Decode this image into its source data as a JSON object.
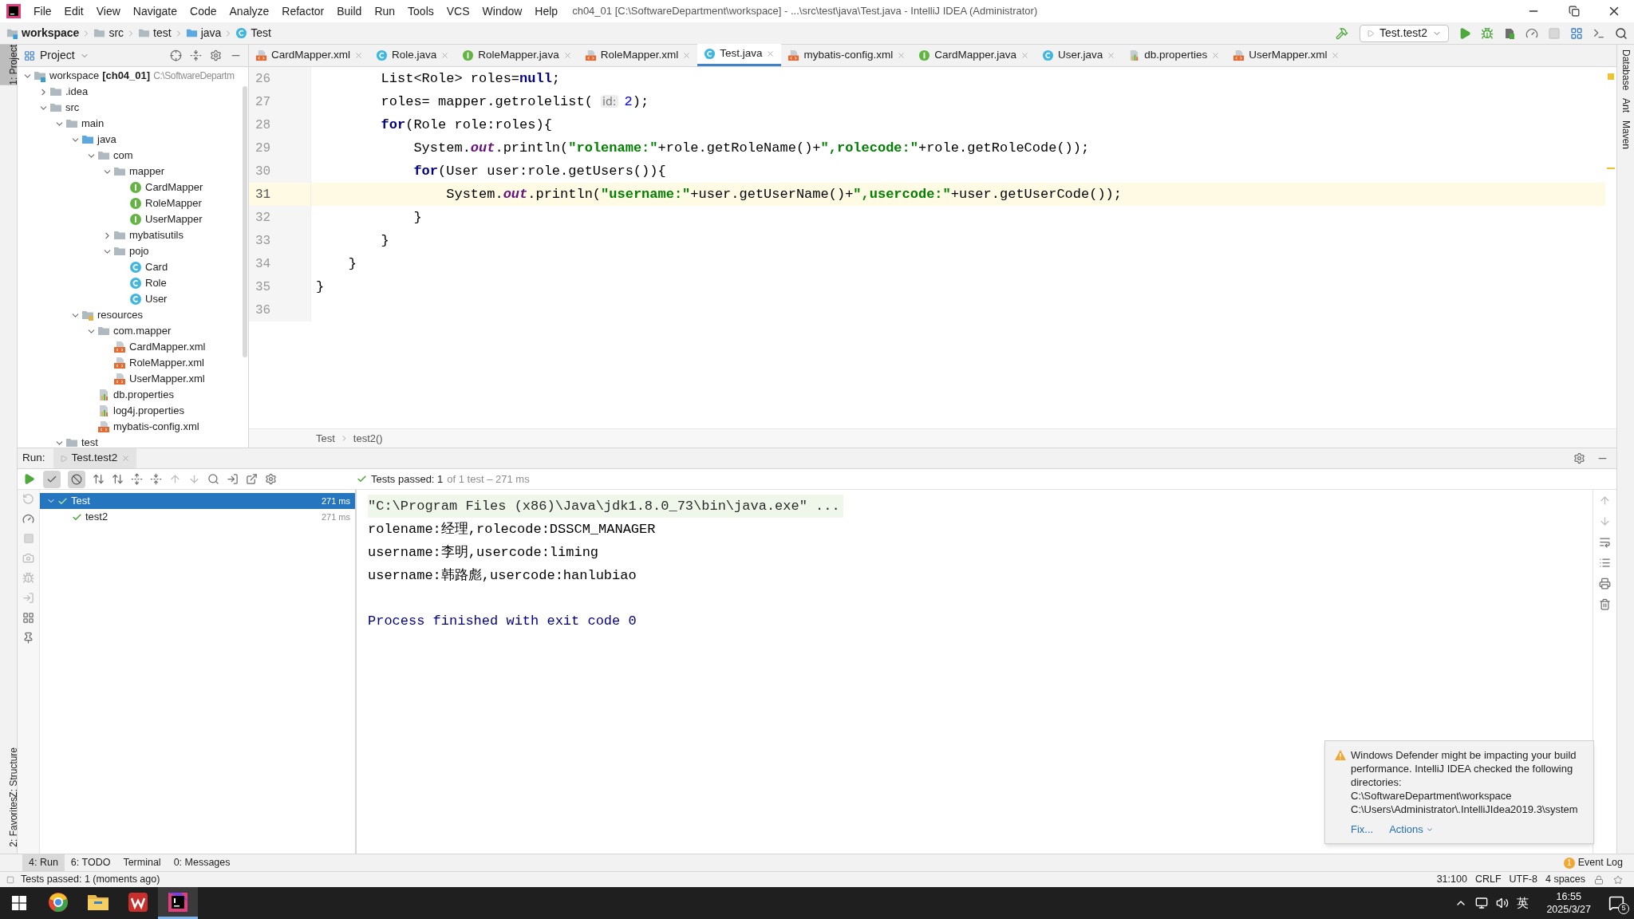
{
  "window": {
    "title": "ch04_01 [C:\\SoftwareDepartment\\workspace] - ...\\src\\test\\java\\Test.java - IntelliJ IDEA (Administrator)",
    "menu": [
      "File",
      "Edit",
      "View",
      "Navigate",
      "Code",
      "Analyze",
      "Refactor",
      "Build",
      "Run",
      "Tools",
      "VCS",
      "Window",
      "Help"
    ]
  },
  "nav_bar": {
    "breadcrumbs": [
      {
        "label": "workspace",
        "kind": "module"
      },
      {
        "label": "src",
        "kind": "folder"
      },
      {
        "label": "test",
        "kind": "folder"
      },
      {
        "label": "java",
        "kind": "source-folder"
      },
      {
        "label": "Test",
        "kind": "class"
      }
    ],
    "run_config": "Test.test2"
  },
  "left_stripe": [
    {
      "label": "1: Project",
      "selected": true
    },
    {
      "label": "Z: Structure",
      "selected": false
    },
    {
      "label": "2: Favorites",
      "selected": false
    }
  ],
  "right_stripe": [
    "Database",
    "Ant",
    "Maven"
  ],
  "project_panel": {
    "title": "Project",
    "tree": [
      {
        "label": "workspace",
        "module": "[ch04_01]",
        "path": "C:\\SoftwareDepartm",
        "kind": "module",
        "expanded": true,
        "children": [
          {
            "label": ".idea",
            "kind": "folder",
            "expanded": false
          },
          {
            "label": "src",
            "kind": "folder",
            "expanded": true,
            "children": [
              {
                "label": "main",
                "kind": "folder",
                "expanded": true,
                "children": [
                  {
                    "label": "java",
                    "kind": "source-folder",
                    "expanded": true,
                    "children": [
                      {
                        "label": "com",
                        "kind": "folder",
                        "expanded": true,
                        "children": [
                          {
                            "label": "mapper",
                            "kind": "folder",
                            "expanded": true,
                            "children": [
                              {
                                "label": "CardMapper",
                                "kind": "interface"
                              },
                              {
                                "label": "RoleMapper",
                                "kind": "interface"
                              },
                              {
                                "label": "UserMapper",
                                "kind": "interface"
                              }
                            ]
                          },
                          {
                            "label": "mybatisutils",
                            "kind": "folder",
                            "expanded": false
                          },
                          {
                            "label": "pojo",
                            "kind": "folder",
                            "expanded": true,
                            "children": [
                              {
                                "label": "Card",
                                "kind": "class"
                              },
                              {
                                "label": "Role",
                                "kind": "class"
                              },
                              {
                                "label": "User",
                                "kind": "class"
                              }
                            ]
                          }
                        ]
                      }
                    ]
                  },
                  {
                    "label": "resources",
                    "kind": "resources-folder",
                    "expanded": true,
                    "children": [
                      {
                        "label": "com.mapper",
                        "kind": "folder",
                        "expanded": true,
                        "children": [
                          {
                            "label": "CardMapper.xml",
                            "kind": "xml"
                          },
                          {
                            "label": "RoleMapper.xml",
                            "kind": "xml"
                          },
                          {
                            "label": "UserMapper.xml",
                            "kind": "xml"
                          }
                        ]
                      },
                      {
                        "label": "db.properties",
                        "kind": "properties"
                      },
                      {
                        "label": "log4j.properties",
                        "kind": "properties"
                      },
                      {
                        "label": "mybatis-config.xml",
                        "kind": "xml"
                      }
                    ]
                  }
                ]
              },
              {
                "label": "test",
                "kind": "folder",
                "expanded": true
              }
            ]
          }
        ]
      }
    ]
  },
  "editor": {
    "tabs": [
      {
        "label": "CardMapper.xml",
        "kind": "xml",
        "selected": false
      },
      {
        "label": "Role.java",
        "kind": "class",
        "selected": false
      },
      {
        "label": "RoleMapper.java",
        "kind": "interface",
        "selected": false
      },
      {
        "label": "RoleMapper.xml",
        "kind": "xml",
        "selected": false
      },
      {
        "label": "Test.java",
        "kind": "class",
        "selected": true
      },
      {
        "label": "mybatis-config.xml",
        "kind": "xml",
        "selected": false
      },
      {
        "label": "CardMapper.java",
        "kind": "interface",
        "selected": false
      },
      {
        "label": "User.java",
        "kind": "class",
        "selected": false
      },
      {
        "label": "db.properties",
        "kind": "properties",
        "selected": false
      },
      {
        "label": "UserMapper.xml",
        "kind": "xml",
        "selected": false
      }
    ],
    "lines": [
      {
        "number": "26",
        "current": false,
        "segments": [
          {
            "kind": "plain",
            "text": "        List<Role> roles="
          },
          {
            "kind": "keyword",
            "text": "null"
          },
          {
            "kind": "plain",
            "text": ";"
          }
        ]
      },
      {
        "number": "27",
        "current": false,
        "segments": [
          {
            "kind": "plain",
            "text": "        roles= mapper.getrolelist( "
          },
          {
            "kind": "hint",
            "text": "id:"
          },
          {
            "kind": "number",
            "text": "2"
          },
          {
            "kind": "plain",
            "text": ");"
          }
        ]
      },
      {
        "number": "28",
        "current": false,
        "segments": [
          {
            "kind": "keyword",
            "text": "        for"
          },
          {
            "kind": "plain",
            "text": "(Role role:roles){"
          }
        ]
      },
      {
        "number": "29",
        "current": false,
        "segments": [
          {
            "kind": "plain",
            "text": "            System."
          },
          {
            "kind": "field",
            "text": "out"
          },
          {
            "kind": "plain",
            "text": ".println("
          },
          {
            "kind": "string",
            "text": "\"rolename:\""
          },
          {
            "kind": "plain",
            "text": "+role.getRoleName()+"
          },
          {
            "kind": "string",
            "text": "\",rolecode:\""
          },
          {
            "kind": "plain",
            "text": "+role.getRoleCode());"
          }
        ]
      },
      {
        "number": "30",
        "current": false,
        "segments": [
          {
            "kind": "keyword",
            "text": "            for"
          },
          {
            "kind": "plain",
            "text": "(User user:role.getUsers()){"
          }
        ]
      },
      {
        "number": "31",
        "current": true,
        "segments": [
          {
            "kind": "plain",
            "text": "                System."
          },
          {
            "kind": "field",
            "text": "out"
          },
          {
            "kind": "plain",
            "text": ".println("
          },
          {
            "kind": "string",
            "text": "\"username:\""
          },
          {
            "kind": "plain",
            "text": "+user.getUserName()+"
          },
          {
            "kind": "string",
            "text": "\",usercode:\""
          },
          {
            "kind": "plain",
            "text": "+user.getUserCode());"
          }
        ]
      },
      {
        "number": "32",
        "current": false,
        "segments": [
          {
            "kind": "plain",
            "text": "            }"
          }
        ]
      },
      {
        "number": "33",
        "current": false,
        "segments": [
          {
            "kind": "plain",
            "text": "        }"
          }
        ]
      },
      {
        "number": "34",
        "current": false,
        "segments": [
          {
            "kind": "plain",
            "text": "    }"
          }
        ]
      },
      {
        "number": "35",
        "current": false,
        "segments": [
          {
            "kind": "plain",
            "text": "}"
          }
        ]
      },
      {
        "number": "36",
        "current": false
      }
    ],
    "breadcrumb": [
      "Test",
      "test2()"
    ]
  },
  "run_panel": {
    "label": "Run:",
    "tab": "Test.test2",
    "toggles": [
      {
        "kind": "show-passed",
        "selected": true
      },
      {
        "kind": "show-ignored",
        "selected": true
      }
    ],
    "status": {
      "summary": "Tests passed: 1",
      "detail": "of 1 test – 271 ms"
    },
    "tests": [
      {
        "name": "Test",
        "time": "271 ms",
        "passed": true,
        "selected": true,
        "expanded": true,
        "children": [
          {
            "name": "test2",
            "time": "271 ms",
            "passed": true,
            "selected": false
          }
        ]
      }
    ],
    "console": [
      {
        "kind": "command",
        "text": "\"C:\\Program Files (x86)\\Java\\jdk1.8.0_73\\bin\\java.exe\" ..."
      },
      {
        "kind": "output",
        "text": "rolename:经理,rolecode:DSSCM_MANAGER"
      },
      {
        "kind": "output",
        "text": "username:李明,usercode:liming"
      },
      {
        "kind": "output",
        "text": "username:韩路彪,usercode:hanlubiao"
      },
      {
        "kind": "exit",
        "text": "Process finished with exit code 0"
      }
    ]
  },
  "notification": {
    "message": "Windows Defender might be impacting your build performance. IntelliJ IDEA checked the following directories:",
    "paths": [
      "C:\\SoftwareDepartment\\workspace",
      "C:\\Users\\Administrator\\.IntelliJIdea2019.3\\system"
    ],
    "links": [
      "Fix...",
      "Actions"
    ]
  },
  "tool_tabs": [
    {
      "label": "4: Run",
      "selected": true
    },
    {
      "label": "6: TODO",
      "selected": false
    },
    {
      "label": "Terminal",
      "selected": false
    },
    {
      "label": "0: Messages",
      "selected": false
    }
  ],
  "event_log": {
    "label": "Event Log",
    "count": "1"
  },
  "status_bar": {
    "message": "Tests passed: 1 (moments ago)",
    "items": [
      "31:100",
      "CRLF",
      "UTF-8",
      "4 spaces"
    ]
  },
  "taskbar": {
    "apps": [
      {
        "kind": "browser",
        "selected": false
      },
      {
        "kind": "files",
        "selected": false
      },
      {
        "kind": "office",
        "selected": false
      },
      {
        "kind": "ide",
        "selected": true
      }
    ],
    "input_method": "英",
    "time": "16:55",
    "date": "2025/3/27",
    "notifications": "5"
  }
}
